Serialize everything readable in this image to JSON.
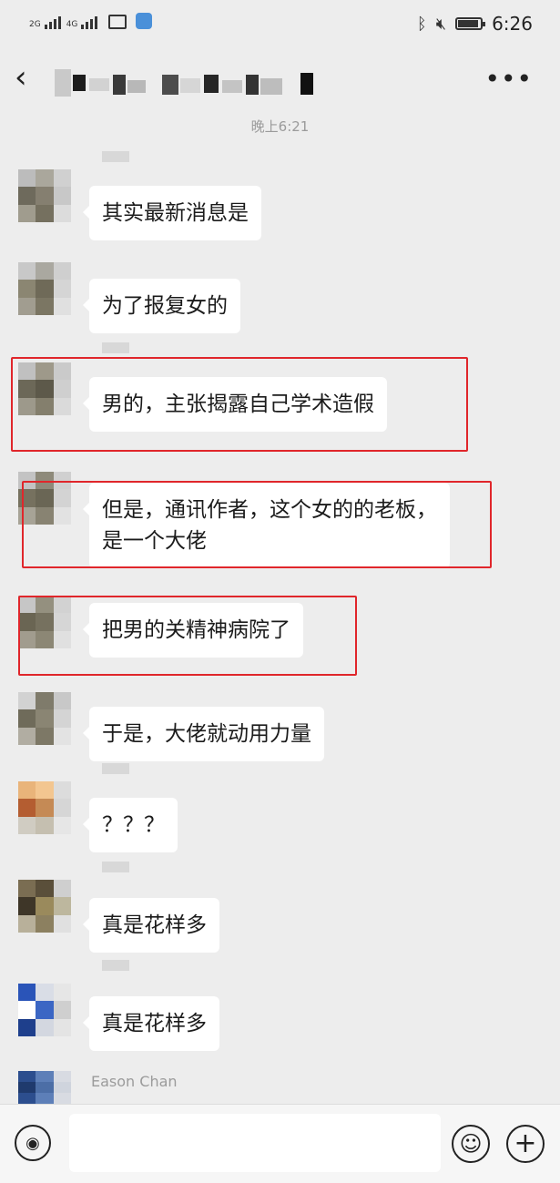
{
  "status": {
    "net1": "2G",
    "net2": "4G",
    "time": "6:26",
    "icons": [
      "signal-icon",
      "activity-icon",
      "shield-icon",
      "bluetooth-icon",
      "mute-icon",
      "battery-icon"
    ]
  },
  "nav": {
    "back_icon": "chevron-left-icon",
    "title_obscured": true,
    "more_label": "•••"
  },
  "timestamp": "晚上6:21",
  "messages": [
    {
      "text": "其实最新消息是",
      "highlighted": false
    },
    {
      "text": "为了报复女的",
      "highlighted": false
    },
    {
      "text": "男的，主张揭露自己学术造假",
      "highlighted": true
    },
    {
      "text": "但是，通讯作者，这个女的的老板，\n是一个大佬",
      "highlighted": true
    },
    {
      "text": "把男的关精神病院了",
      "highlighted": true
    },
    {
      "text": "于是，大佬就动用力量",
      "highlighted": false
    },
    {
      "text": "？？？",
      "highlighted": false
    },
    {
      "text": "真是花样多",
      "highlighted": false
    },
    {
      "text": "真是花样多",
      "highlighted": false
    }
  ],
  "last_sender": "Eason Chan",
  "input": {
    "voice_icon": "voice-icon",
    "emoji_icon": "emoji-icon",
    "plus_icon": "plus-icon",
    "emoji_glyph": "☺",
    "plus_glyph": "+",
    "voice_glyph": "◉"
  },
  "colors": {
    "background": "#ededed",
    "bubble": "#ffffff",
    "highlight_box": "#e0262b"
  }
}
